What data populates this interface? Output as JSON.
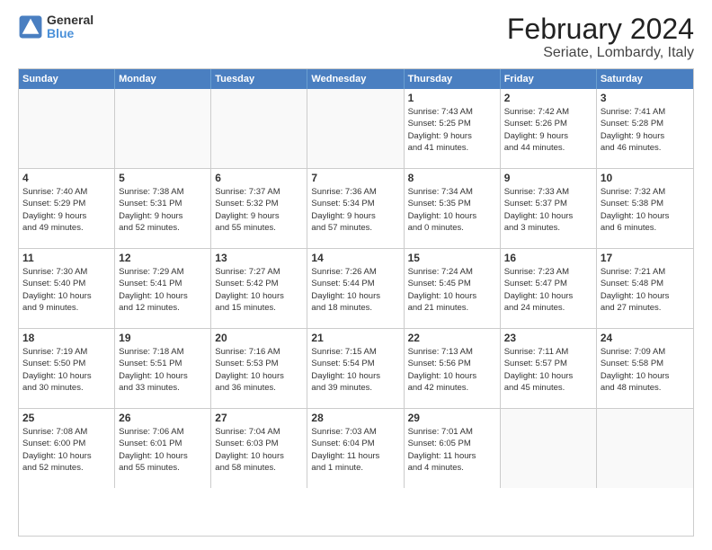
{
  "logo": {
    "line1": "General",
    "line2": "Blue"
  },
  "title": "February 2024",
  "subtitle": "Seriate, Lombardy, Italy",
  "weekdays": [
    "Sunday",
    "Monday",
    "Tuesday",
    "Wednesday",
    "Thursday",
    "Friday",
    "Saturday"
  ],
  "weeks": [
    [
      {
        "day": "",
        "info": ""
      },
      {
        "day": "",
        "info": ""
      },
      {
        "day": "",
        "info": ""
      },
      {
        "day": "",
        "info": ""
      },
      {
        "day": "1",
        "info": "Sunrise: 7:43 AM\nSunset: 5:25 PM\nDaylight: 9 hours\nand 41 minutes."
      },
      {
        "day": "2",
        "info": "Sunrise: 7:42 AM\nSunset: 5:26 PM\nDaylight: 9 hours\nand 44 minutes."
      },
      {
        "day": "3",
        "info": "Sunrise: 7:41 AM\nSunset: 5:28 PM\nDaylight: 9 hours\nand 46 minutes."
      }
    ],
    [
      {
        "day": "4",
        "info": "Sunrise: 7:40 AM\nSunset: 5:29 PM\nDaylight: 9 hours\nand 49 minutes."
      },
      {
        "day": "5",
        "info": "Sunrise: 7:38 AM\nSunset: 5:31 PM\nDaylight: 9 hours\nand 52 minutes."
      },
      {
        "day": "6",
        "info": "Sunrise: 7:37 AM\nSunset: 5:32 PM\nDaylight: 9 hours\nand 55 minutes."
      },
      {
        "day": "7",
        "info": "Sunrise: 7:36 AM\nSunset: 5:34 PM\nDaylight: 9 hours\nand 57 minutes."
      },
      {
        "day": "8",
        "info": "Sunrise: 7:34 AM\nSunset: 5:35 PM\nDaylight: 10 hours\nand 0 minutes."
      },
      {
        "day": "9",
        "info": "Sunrise: 7:33 AM\nSunset: 5:37 PM\nDaylight: 10 hours\nand 3 minutes."
      },
      {
        "day": "10",
        "info": "Sunrise: 7:32 AM\nSunset: 5:38 PM\nDaylight: 10 hours\nand 6 minutes."
      }
    ],
    [
      {
        "day": "11",
        "info": "Sunrise: 7:30 AM\nSunset: 5:40 PM\nDaylight: 10 hours\nand 9 minutes."
      },
      {
        "day": "12",
        "info": "Sunrise: 7:29 AM\nSunset: 5:41 PM\nDaylight: 10 hours\nand 12 minutes."
      },
      {
        "day": "13",
        "info": "Sunrise: 7:27 AM\nSunset: 5:42 PM\nDaylight: 10 hours\nand 15 minutes."
      },
      {
        "day": "14",
        "info": "Sunrise: 7:26 AM\nSunset: 5:44 PM\nDaylight: 10 hours\nand 18 minutes."
      },
      {
        "day": "15",
        "info": "Sunrise: 7:24 AM\nSunset: 5:45 PM\nDaylight: 10 hours\nand 21 minutes."
      },
      {
        "day": "16",
        "info": "Sunrise: 7:23 AM\nSunset: 5:47 PM\nDaylight: 10 hours\nand 24 minutes."
      },
      {
        "day": "17",
        "info": "Sunrise: 7:21 AM\nSunset: 5:48 PM\nDaylight: 10 hours\nand 27 minutes."
      }
    ],
    [
      {
        "day": "18",
        "info": "Sunrise: 7:19 AM\nSunset: 5:50 PM\nDaylight: 10 hours\nand 30 minutes."
      },
      {
        "day": "19",
        "info": "Sunrise: 7:18 AM\nSunset: 5:51 PM\nDaylight: 10 hours\nand 33 minutes."
      },
      {
        "day": "20",
        "info": "Sunrise: 7:16 AM\nSunset: 5:53 PM\nDaylight: 10 hours\nand 36 minutes."
      },
      {
        "day": "21",
        "info": "Sunrise: 7:15 AM\nSunset: 5:54 PM\nDaylight: 10 hours\nand 39 minutes."
      },
      {
        "day": "22",
        "info": "Sunrise: 7:13 AM\nSunset: 5:56 PM\nDaylight: 10 hours\nand 42 minutes."
      },
      {
        "day": "23",
        "info": "Sunrise: 7:11 AM\nSunset: 5:57 PM\nDaylight: 10 hours\nand 45 minutes."
      },
      {
        "day": "24",
        "info": "Sunrise: 7:09 AM\nSunset: 5:58 PM\nDaylight: 10 hours\nand 48 minutes."
      }
    ],
    [
      {
        "day": "25",
        "info": "Sunrise: 7:08 AM\nSunset: 6:00 PM\nDaylight: 10 hours\nand 52 minutes."
      },
      {
        "day": "26",
        "info": "Sunrise: 7:06 AM\nSunset: 6:01 PM\nDaylight: 10 hours\nand 55 minutes."
      },
      {
        "day": "27",
        "info": "Sunrise: 7:04 AM\nSunset: 6:03 PM\nDaylight: 10 hours\nand 58 minutes."
      },
      {
        "day": "28",
        "info": "Sunrise: 7:03 AM\nSunset: 6:04 PM\nDaylight: 11 hours\nand 1 minute."
      },
      {
        "day": "29",
        "info": "Sunrise: 7:01 AM\nSunset: 6:05 PM\nDaylight: 11 hours\nand 4 minutes."
      },
      {
        "day": "",
        "info": ""
      },
      {
        "day": "",
        "info": ""
      }
    ]
  ]
}
